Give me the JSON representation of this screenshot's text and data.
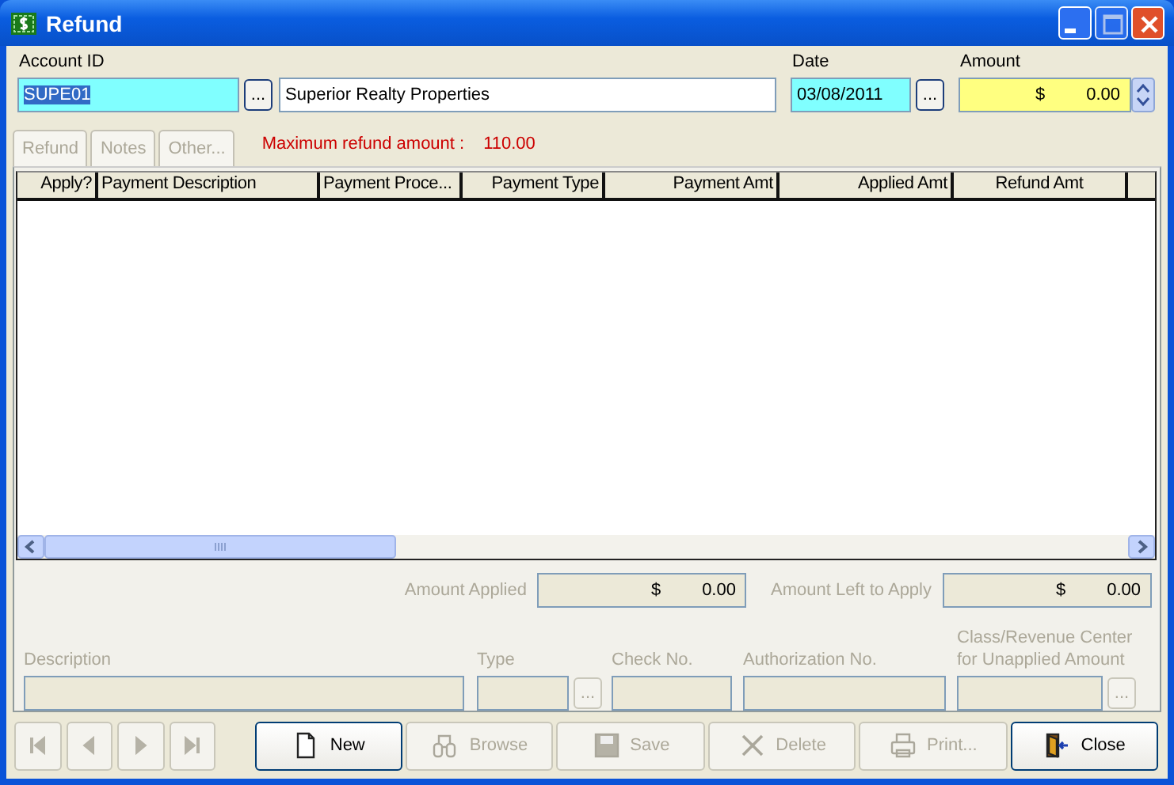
{
  "window": {
    "title": "Refund"
  },
  "account": {
    "label": "Account ID",
    "value": "SUPE01",
    "button": "...",
    "name": "Superior Realty Properties"
  },
  "date": {
    "label": "Date",
    "value": "03/08/2011",
    "button": "..."
  },
  "amount": {
    "label": "Amount",
    "currency": "$",
    "value": "0.00"
  },
  "tabs": [
    {
      "label": "Refund",
      "disabled": true
    },
    {
      "label": "Notes",
      "disabled": true
    },
    {
      "label": "Other...",
      "disabled": true
    }
  ],
  "max_refund": {
    "label": "Maximum refund amount :",
    "value": "110.00"
  },
  "table": {
    "columns": [
      "Apply?",
      "Payment Description",
      "Payment Proce...",
      "Payment Type",
      "Payment Amt",
      "Applied Amt",
      "Refund Amt"
    ]
  },
  "summary": [
    {
      "label": "Amount Applied",
      "currency": "$",
      "value": "0.00"
    },
    {
      "label": "Amount Left to Apply",
      "currency": "$",
      "value": "0.00"
    }
  ],
  "details": [
    {
      "label": "Description"
    },
    {
      "label": "Type",
      "button": "..."
    },
    {
      "label": "Check No."
    },
    {
      "label": "Authorization No."
    },
    {
      "label": "Class/Revenue Center for Unapplied Amount",
      "button": "..."
    }
  ],
  "navigation": [
    {
      "kind": "first",
      "disabled": true
    },
    {
      "kind": "previous",
      "disabled": true
    },
    {
      "kind": "next",
      "disabled": true
    },
    {
      "kind": "last",
      "disabled": true
    }
  ],
  "actions": [
    {
      "kind": "new",
      "label": "New",
      "disabled": false
    },
    {
      "kind": "browse",
      "label": "Browse",
      "disabled": true
    },
    {
      "kind": "save",
      "label": "Save",
      "disabled": true
    },
    {
      "kind": "delete",
      "label": "Delete",
      "disabled": true
    },
    {
      "kind": "print",
      "label": "Print...",
      "disabled": true
    },
    {
      "kind": "close",
      "label": "Close",
      "disabled": false
    }
  ]
}
